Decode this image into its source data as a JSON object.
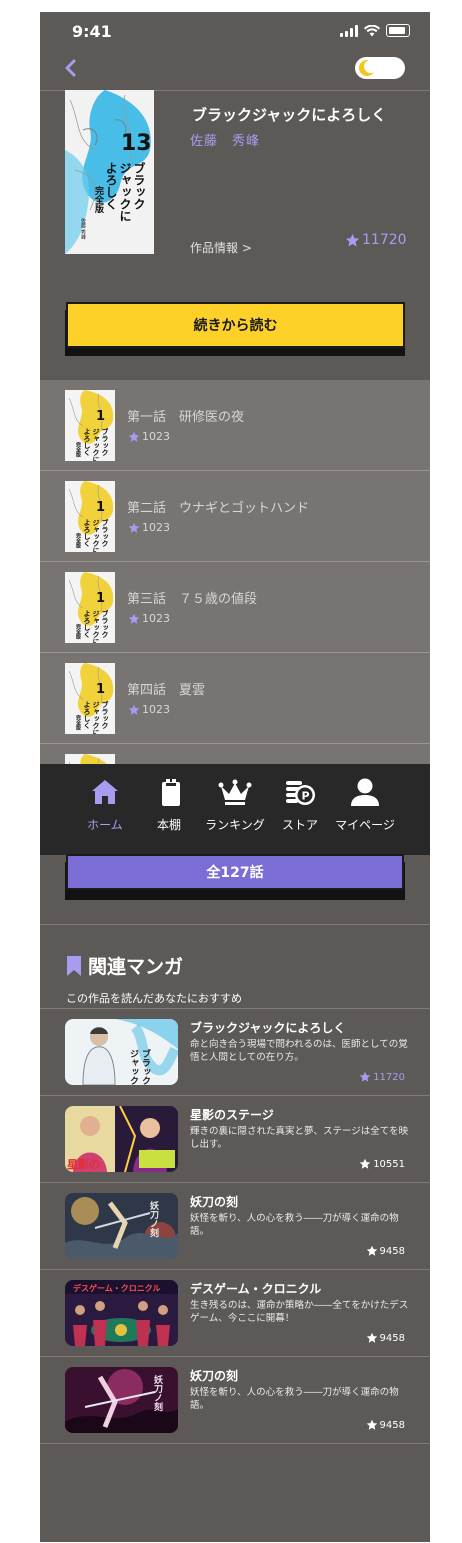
{
  "status_bar": {
    "time": "9:41"
  },
  "manga": {
    "title": "ブラックジャックによろしく",
    "author": "佐藤　秀峰",
    "info_link": "作品情報 >",
    "rating": "11720",
    "cover_volume": "13",
    "cover_title": "ブラックジャックによろしく",
    "cover_edition": "完全版",
    "cover_author": "佐藤 秀峰"
  },
  "continue_label": "続きから読む",
  "episodes": [
    {
      "title": "第一話　研修医の夜",
      "rating": "1023"
    },
    {
      "title": "第二話　ウナギとゴットハンド",
      "rating": "1023"
    },
    {
      "title": "第三話　７５歳の値段",
      "rating": "1023"
    },
    {
      "title": "第四話　夏雲",
      "rating": "1023"
    }
  ],
  "episode_cover_volume": "1",
  "tabs": [
    {
      "label": "ホーム",
      "icon": "home-icon",
      "active": true
    },
    {
      "label": "本棚",
      "icon": "bookshelf-icon",
      "active": false
    },
    {
      "label": "ランキング",
      "icon": "crown-icon",
      "active": false
    },
    {
      "label": "ストア",
      "icon": "coins-icon",
      "active": false
    },
    {
      "label": "マイページ",
      "icon": "person-icon",
      "active": false
    }
  ],
  "all_episodes_label": "全127話",
  "related": {
    "title": "関連マンガ",
    "subtitle": "この作品を読んだあなたにおすすめ",
    "items": [
      {
        "title": "ブラックジャックによろしく",
        "desc": "命と向き合う現場で問われるのは、医師としての覚悟と人間としての在り方。",
        "rating": "11720",
        "accent": true
      },
      {
        "title": "星影のステージ",
        "desc": "輝きの裏に隠された真実と夢、ステージは全てを映し出す。",
        "rating": "10551",
        "accent": false
      },
      {
        "title": "妖刀の刻",
        "desc": "妖怪を斬り、人の心を救う――刀が導く運命の物語。",
        "rating": "9458",
        "accent": false
      },
      {
        "title": "デスゲーム・クロニクル",
        "desc": "生き残るのは、運命か策略か――全てをかけたデスゲーム、今ここに開幕！",
        "rating": "9458",
        "accent": false
      },
      {
        "title": "妖刀の刻",
        "desc": "妖怪を斬り、人の心を救う――刀が導く運命の物語。",
        "rating": "9458",
        "accent": false
      }
    ]
  },
  "colors": {
    "background": "#5d5957",
    "accent": "#a89cf0",
    "continue_button": "#fdd128",
    "all_button": "#7a6ed6",
    "tabbar": "#282828"
  }
}
